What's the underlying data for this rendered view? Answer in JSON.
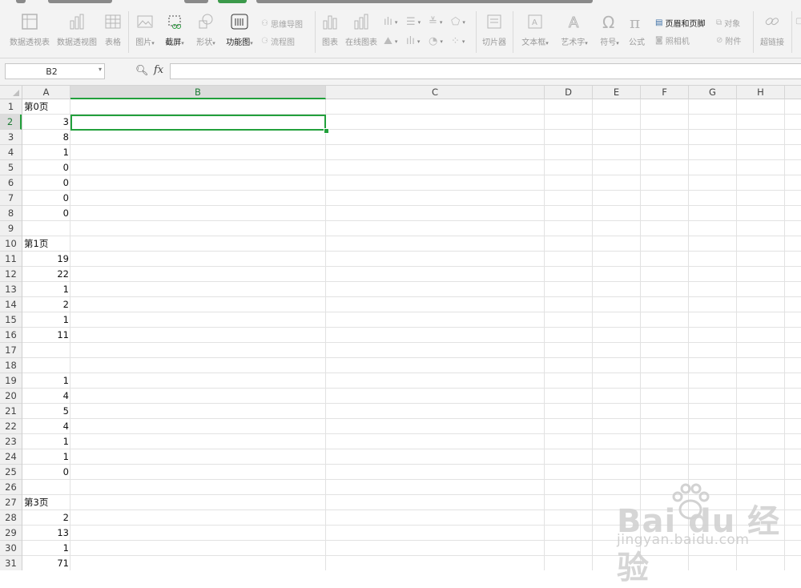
{
  "ribbon": {
    "pivot_table": "数据透视表",
    "pivot_chart": "数据透视图",
    "table": "表格",
    "picture": "图片",
    "screenshot": "截屏",
    "shapes": "形状",
    "function_chart": "功能图",
    "mind_map": "思维导图",
    "flowchart": "流程图",
    "chart": "图表",
    "online_chart": "在线图表",
    "slicer": "切片器",
    "text_box": "文本框",
    "art_text": "艺术字",
    "symbol": "符号",
    "formula": "公式",
    "header_footer": "页眉和页脚",
    "object": "对象",
    "camera": "照相机",
    "attachment": "附件",
    "hyperlink": "超链接"
  },
  "formula_bar": {
    "cell_ref": "B2",
    "fx_label": "fx",
    "formula": ""
  },
  "columns": [
    "A",
    "B",
    "C",
    "D",
    "E",
    "F",
    "G",
    "H"
  ],
  "selected_column": "B",
  "selected_row": "2",
  "rows": [
    {
      "n": "1",
      "a": "第0页",
      "kind": "txt"
    },
    {
      "n": "2",
      "a": "3",
      "kind": "num"
    },
    {
      "n": "3",
      "a": "8",
      "kind": "num"
    },
    {
      "n": "4",
      "a": "1",
      "kind": "num"
    },
    {
      "n": "5",
      "a": "0",
      "kind": "num"
    },
    {
      "n": "6",
      "a": "0",
      "kind": "num"
    },
    {
      "n": "7",
      "a": "0",
      "kind": "num"
    },
    {
      "n": "8",
      "a": "0",
      "kind": "num"
    },
    {
      "n": "9",
      "a": "",
      "kind": "txt"
    },
    {
      "n": "10",
      "a": "第1页",
      "kind": "txt"
    },
    {
      "n": "11",
      "a": "19",
      "kind": "num"
    },
    {
      "n": "12",
      "a": "22",
      "kind": "num"
    },
    {
      "n": "13",
      "a": "1",
      "kind": "num"
    },
    {
      "n": "14",
      "a": "2",
      "kind": "num"
    },
    {
      "n": "15",
      "a": "1",
      "kind": "num"
    },
    {
      "n": "16",
      "a": "11",
      "kind": "num"
    },
    {
      "n": "17",
      "a": "",
      "kind": "txt"
    },
    {
      "n": "18",
      "a": "",
      "kind": "txt"
    },
    {
      "n": "19",
      "a": "1",
      "kind": "num"
    },
    {
      "n": "20",
      "a": "4",
      "kind": "num"
    },
    {
      "n": "21",
      "a": "5",
      "kind": "num"
    },
    {
      "n": "22",
      "a": "4",
      "kind": "num"
    },
    {
      "n": "23",
      "a": "1",
      "kind": "num"
    },
    {
      "n": "24",
      "a": "1",
      "kind": "num"
    },
    {
      "n": "25",
      "a": "0",
      "kind": "num"
    },
    {
      "n": "26",
      "a": "",
      "kind": "txt"
    },
    {
      "n": "27",
      "a": "第3页",
      "kind": "txt"
    },
    {
      "n": "28",
      "a": "2",
      "kind": "num"
    },
    {
      "n": "29",
      "a": "13",
      "kind": "num"
    },
    {
      "n": "30",
      "a": "1",
      "kind": "num"
    },
    {
      "n": "31",
      "a": "71",
      "kind": "num"
    }
  ],
  "watermark": {
    "logo": "Bai du 经验",
    "url": "jingyan.baidu.com"
  },
  "colors": {
    "selection": "#22a03c",
    "header_bg": "#f0f0f0",
    "ribbon_bg": "#f3f3f3"
  }
}
